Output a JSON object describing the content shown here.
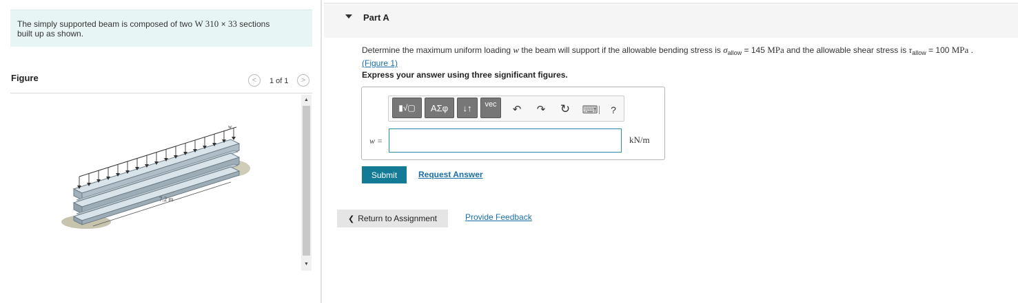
{
  "problem": {
    "text_before": "The simply supported beam is composed of two ",
    "section_name": "W 310",
    "times": "×",
    "section_value": "33",
    "text_after": " sections",
    "line2": "built up as shown."
  },
  "figure": {
    "label": "Figure",
    "pager": "1 of 1",
    "prev_glyph": "<",
    "next_glyph": ">",
    "load_label": "w",
    "length_label": "7.2 m",
    "scroll_up": "▲",
    "scroll_down": "▼"
  },
  "part": {
    "title": "Part A",
    "question_pre": "Determine the maximum uniform loading ",
    "question_var": "w",
    "question_mid": " the beam will support if the allowable bending stress is ",
    "sigma": "σ",
    "sigma_sub": "allow",
    "eq1": " = 145 ",
    "unit1": "MPa",
    "question_mid2": " and the allowable shear stress is ",
    "tau": "τ",
    "tau_sub": "allow",
    "eq2": " = 100 ",
    "unit2": "MPa",
    "period": " .",
    "figure_link": "(Figure 1)",
    "instruction": "Express your answer using three significant figures."
  },
  "toolbar": {
    "templates_glyph": "▮√▢",
    "greek_label": "ΑΣφ",
    "arrows_label": "↓↑",
    "vec_label": "vec",
    "undo_glyph": "↶",
    "redo_glyph": "↷",
    "reset_glyph": "↻",
    "keyboard_glyph": "⌨",
    "help_label": "?"
  },
  "answer": {
    "var_label": "w =",
    "value": "",
    "unit": "kN/m"
  },
  "actions": {
    "submit": "Submit",
    "request": "Request Answer",
    "return_label": "Return to Assignment",
    "return_glyph": "❮",
    "feedback": "Provide Feedback"
  },
  "colors": {
    "problem_bg": "#e8f5f5",
    "submit_bg": "#137b95",
    "link": "#1a6fa8",
    "input_border": "#2a8fa6"
  }
}
